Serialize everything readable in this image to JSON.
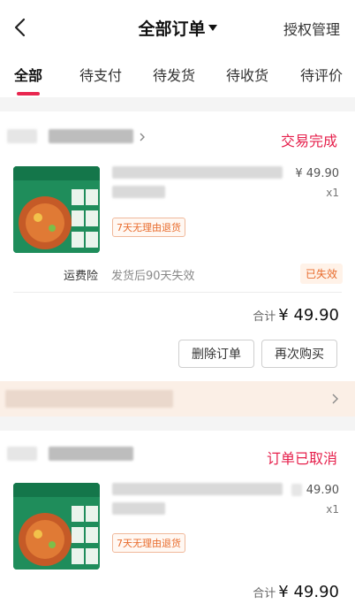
{
  "header": {
    "title": "全部订单",
    "auth_label": "授权管理"
  },
  "tabs": [
    {
      "label": "全部"
    },
    {
      "label": "待支付"
    },
    {
      "label": "待发货"
    },
    {
      "label": "待收货"
    },
    {
      "label": "待评价"
    }
  ],
  "orders": [
    {
      "status": "交易完成",
      "price": "¥ 49.90",
      "qty": "x1",
      "badge": "7天无理由退货",
      "freight": {
        "label": "运费险",
        "desc": "发货后90天失效",
        "state": "已失效"
      },
      "total_label": "合计",
      "total": "¥ 49.90",
      "buttons": {
        "delete": "删除订单",
        "rebuy": "再次购买"
      }
    },
    {
      "status": "订单已取消",
      "price": "49.90",
      "qty": "x1",
      "badge": "7天无理由退货",
      "total_label": "合计",
      "total": "¥ 49.90"
    }
  ],
  "colors": {
    "accent": "#e6204c",
    "badge": "#e86b2c",
    "thumb_green": "#1f8d5b"
  },
  "icons": {
    "back": "chevron-left-icon",
    "title_dropdown": "caret-down-icon",
    "shop_link": "chevron-right-icon"
  }
}
